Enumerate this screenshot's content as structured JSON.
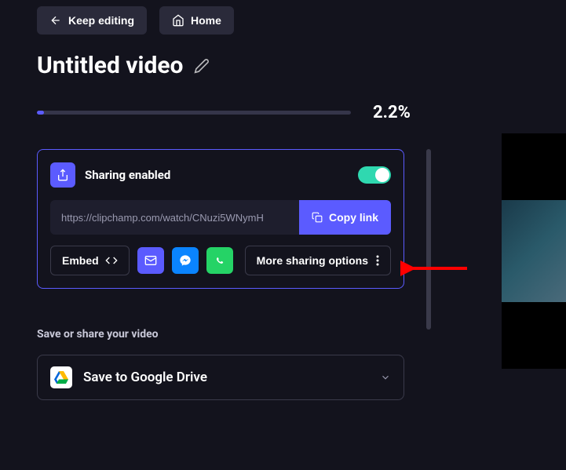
{
  "topButtons": {
    "keepEditing": "Keep editing",
    "home": "Home"
  },
  "title": "Untitled video",
  "progress": {
    "percent": 2.2,
    "displayText": "2.2%"
  },
  "sharing": {
    "title": "Sharing enabled",
    "enabled": true,
    "link": "https://clipchamp.com/watch/CNuzi5WNymH",
    "copyLabel": "Copy link",
    "embedLabel": "Embed",
    "moreLabel": "More sharing options"
  },
  "saveSection": {
    "heading": "Save or share your video",
    "googleDrive": "Save to Google Drive"
  },
  "colors": {
    "accent": "#5b5bff",
    "toggleOn": "#2fd8b0",
    "bg": "#13131d"
  }
}
